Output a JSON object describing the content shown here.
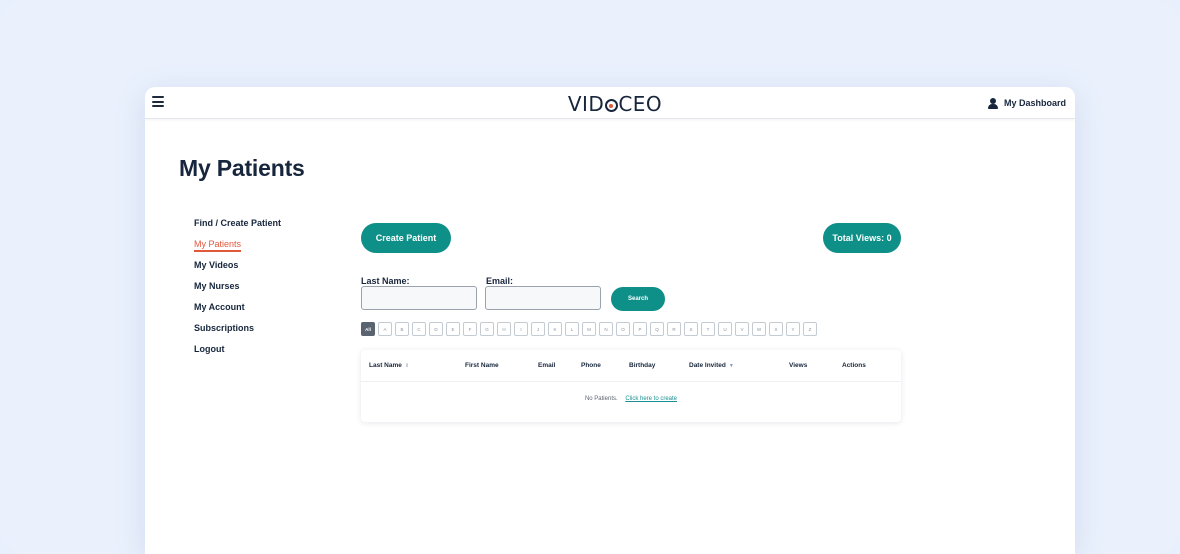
{
  "app": {
    "logo": "VIDOCEO"
  },
  "header": {
    "dashboard_label": "My Dashboard"
  },
  "page": {
    "title": "My Patients"
  },
  "sidebar": {
    "items": [
      {
        "label": "Find / Create Patient",
        "active": false
      },
      {
        "label": "My Patients",
        "active": true
      },
      {
        "label": "My Videos",
        "active": false
      },
      {
        "label": "My Nurses",
        "active": false
      },
      {
        "label": "My Account",
        "active": false
      },
      {
        "label": "Subscriptions",
        "active": false
      },
      {
        "label": "Logout",
        "active": false
      }
    ]
  },
  "actions": {
    "create_label": "Create Patient",
    "total_views_label": "Total Views: 0",
    "search_label": "Search"
  },
  "filters": {
    "last_name_label": "Last Name:",
    "last_name_value": "",
    "email_label": "Email:",
    "email_value": ""
  },
  "alphabet": [
    "All",
    "A",
    "B",
    "C",
    "D",
    "E",
    "F",
    "G",
    "H",
    "I",
    "J",
    "K",
    "L",
    "M",
    "N",
    "O",
    "P",
    "Q",
    "R",
    "S",
    "T",
    "U",
    "V",
    "W",
    "X",
    "Y",
    "Z"
  ],
  "table": {
    "columns": [
      "Last Name",
      "First Name",
      "Email",
      "Phone",
      "Birthday",
      "Date Invited",
      "Views",
      "Actions"
    ],
    "empty_text": "No Patients.",
    "empty_link": "Click here to create"
  },
  "colors": {
    "accent": "#0e8f88",
    "active_nav": "#e0593b",
    "text": "#17263c"
  },
  "icons": {
    "menu": "hamburger-icon",
    "user": "user-icon"
  }
}
